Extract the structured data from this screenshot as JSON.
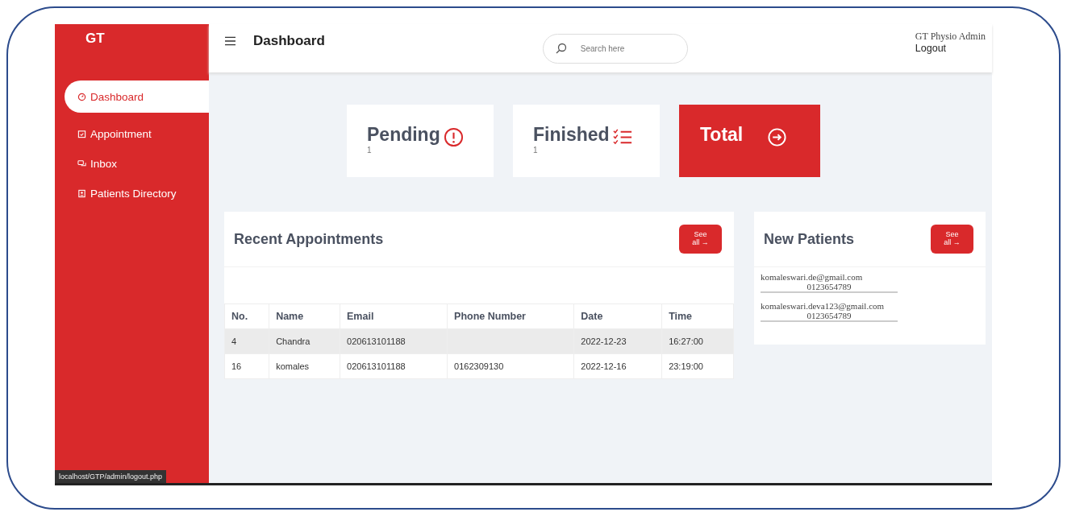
{
  "brand": "GT",
  "sidebar": {
    "items": [
      {
        "label": "Dashboard",
        "kind": "gauge",
        "selected": true
      },
      {
        "label": "Appointment",
        "kind": "calendar",
        "selected": false
      },
      {
        "label": "Inbox",
        "kind": "chat",
        "selected": false
      },
      {
        "label": "Patients Directory",
        "kind": "contact",
        "selected": false
      }
    ]
  },
  "header": {
    "title": "Dashboard",
    "search": {
      "placeholder": "Search here"
    },
    "user": "GT Physio Admin",
    "logout": "Logout"
  },
  "stats": [
    {
      "kind": "pending",
      "label": "Pending",
      "count": "1"
    },
    {
      "kind": "finished",
      "label": "Finished",
      "count": "1"
    },
    {
      "kind": "total",
      "label": "Total"
    }
  ],
  "recent_appointments": {
    "title": "Recent Appointments",
    "button": "See all →",
    "columns": [
      "No.",
      "Name",
      "Email",
      "Phone Number",
      "Date",
      "Time"
    ],
    "rows": [
      {
        "selected": true,
        "cells": [
          "4",
          "Chandra",
          "020613101188",
          "",
          "2022-12-23",
          "16:27:00"
        ]
      },
      {
        "selected": false,
        "cells": [
          "16",
          "komales",
          "020613101188",
          "0162309130",
          "2022-12-16",
          "23:19:00"
        ]
      }
    ]
  },
  "new_patients": {
    "title": "New Patients",
    "button": "See all →",
    "items": [
      {
        "email": "komaleswari.de@gmail.com",
        "phone": "0123654789"
      },
      {
        "email": "komaleswari.deva123@gmail.com",
        "phone": "0123654789"
      }
    ]
  },
  "status_bar": "localhost/GTP/admin/logout.php"
}
